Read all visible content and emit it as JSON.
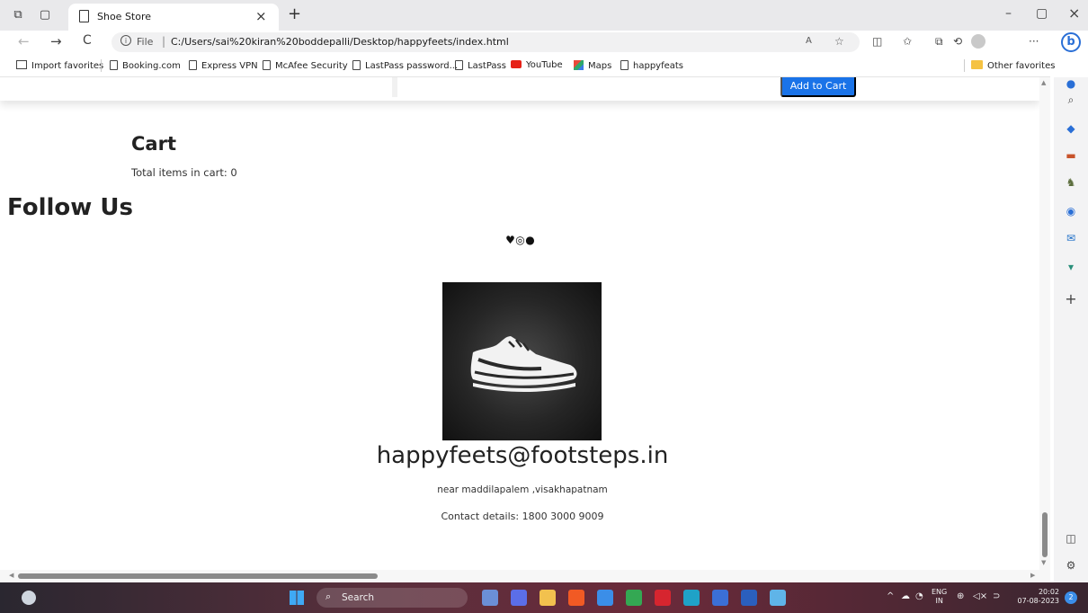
{
  "browser": {
    "tab": {
      "title": "Shoe Store",
      "close_glyph": "×"
    },
    "new_tab_glyph": "+",
    "window_controls": {
      "minimize": "–",
      "restore": "▢",
      "close": "×"
    },
    "nav": {
      "back": "←",
      "forward": "→",
      "refresh": "C"
    },
    "address": {
      "info_glyph": "i",
      "scheme": "File",
      "separator": "|",
      "url": "C:/Users/sai%20kiran%20boddepalli/Desktop/happyfeets/index.html"
    },
    "toolbar_glyphs": {
      "read_aloud": "A",
      "favorite": "☆",
      "split": "◫",
      "favorites": "✩",
      "collections": "⧉",
      "copilot": "⟲",
      "more": "···"
    },
    "bing_glyph": "b",
    "favorites": [
      {
        "label": "Import favorites",
        "icon": "import-icon"
      },
      {
        "label": "Booking.com",
        "icon": "page-icon"
      },
      {
        "label": "Express VPN",
        "icon": "page-icon"
      },
      {
        "label": "McAfee Security",
        "icon": "page-icon"
      },
      {
        "label": "LastPass password...",
        "icon": "page-icon"
      },
      {
        "label": "LastPass",
        "icon": "page-icon"
      },
      {
        "label": "YouTube",
        "icon": "youtube-icon"
      },
      {
        "label": "Maps",
        "icon": "maps-icon"
      },
      {
        "label": "happyfeats",
        "icon": "page-icon"
      }
    ],
    "other_favorites": "Other favorites",
    "sidebar_glyphs": {
      "bell": "●",
      "search": "⌕",
      "tag": "◆",
      "tools": "▬",
      "games": "♞",
      "office": "◉",
      "outlook": "✉",
      "drop": "▾",
      "add": "+",
      "panel": "◫",
      "settings": "⚙"
    }
  },
  "page": {
    "add_to_cart_label": "Add to Cart",
    "cart": {
      "title": "Cart",
      "total_label": "Total items in cart: 0"
    },
    "follow": {
      "title": "Follow Us",
      "twitter_glyph": "♥",
      "instagram_glyph": "◎",
      "facebook_glyph": "●"
    },
    "email": "happyfeets@footsteps.in",
    "address": "near maddilapalem ,visakhapatnam",
    "contact": "Contact details: 1800 3000 9009"
  },
  "taskbar": {
    "search_label": "Search",
    "search_glyph": "⌕",
    "tray_chevron": "^",
    "lang_line1": "ENG",
    "lang_line2": "IN",
    "time": "20:02",
    "date": "07-08-2023",
    "notification_count": "2",
    "apps": [
      {
        "name": "widgets",
        "color": "#6b8fd6"
      },
      {
        "name": "meet",
        "color": "#5b6ee8"
      },
      {
        "name": "file-explorer",
        "color": "#f2c14e"
      },
      {
        "name": "brave",
        "color": "#f15a24"
      },
      {
        "name": "store",
        "color": "#3b8ee8"
      },
      {
        "name": "chrome",
        "color": "#34a853"
      },
      {
        "name": "mcafee",
        "color": "#d6252f"
      },
      {
        "name": "edge",
        "color": "#1fa2c7"
      },
      {
        "name": "photos",
        "color": "#3b6fd6"
      },
      {
        "name": "word",
        "color": "#2b5fbd"
      },
      {
        "name": "notepad",
        "color": "#5fb4e8"
      }
    ]
  }
}
